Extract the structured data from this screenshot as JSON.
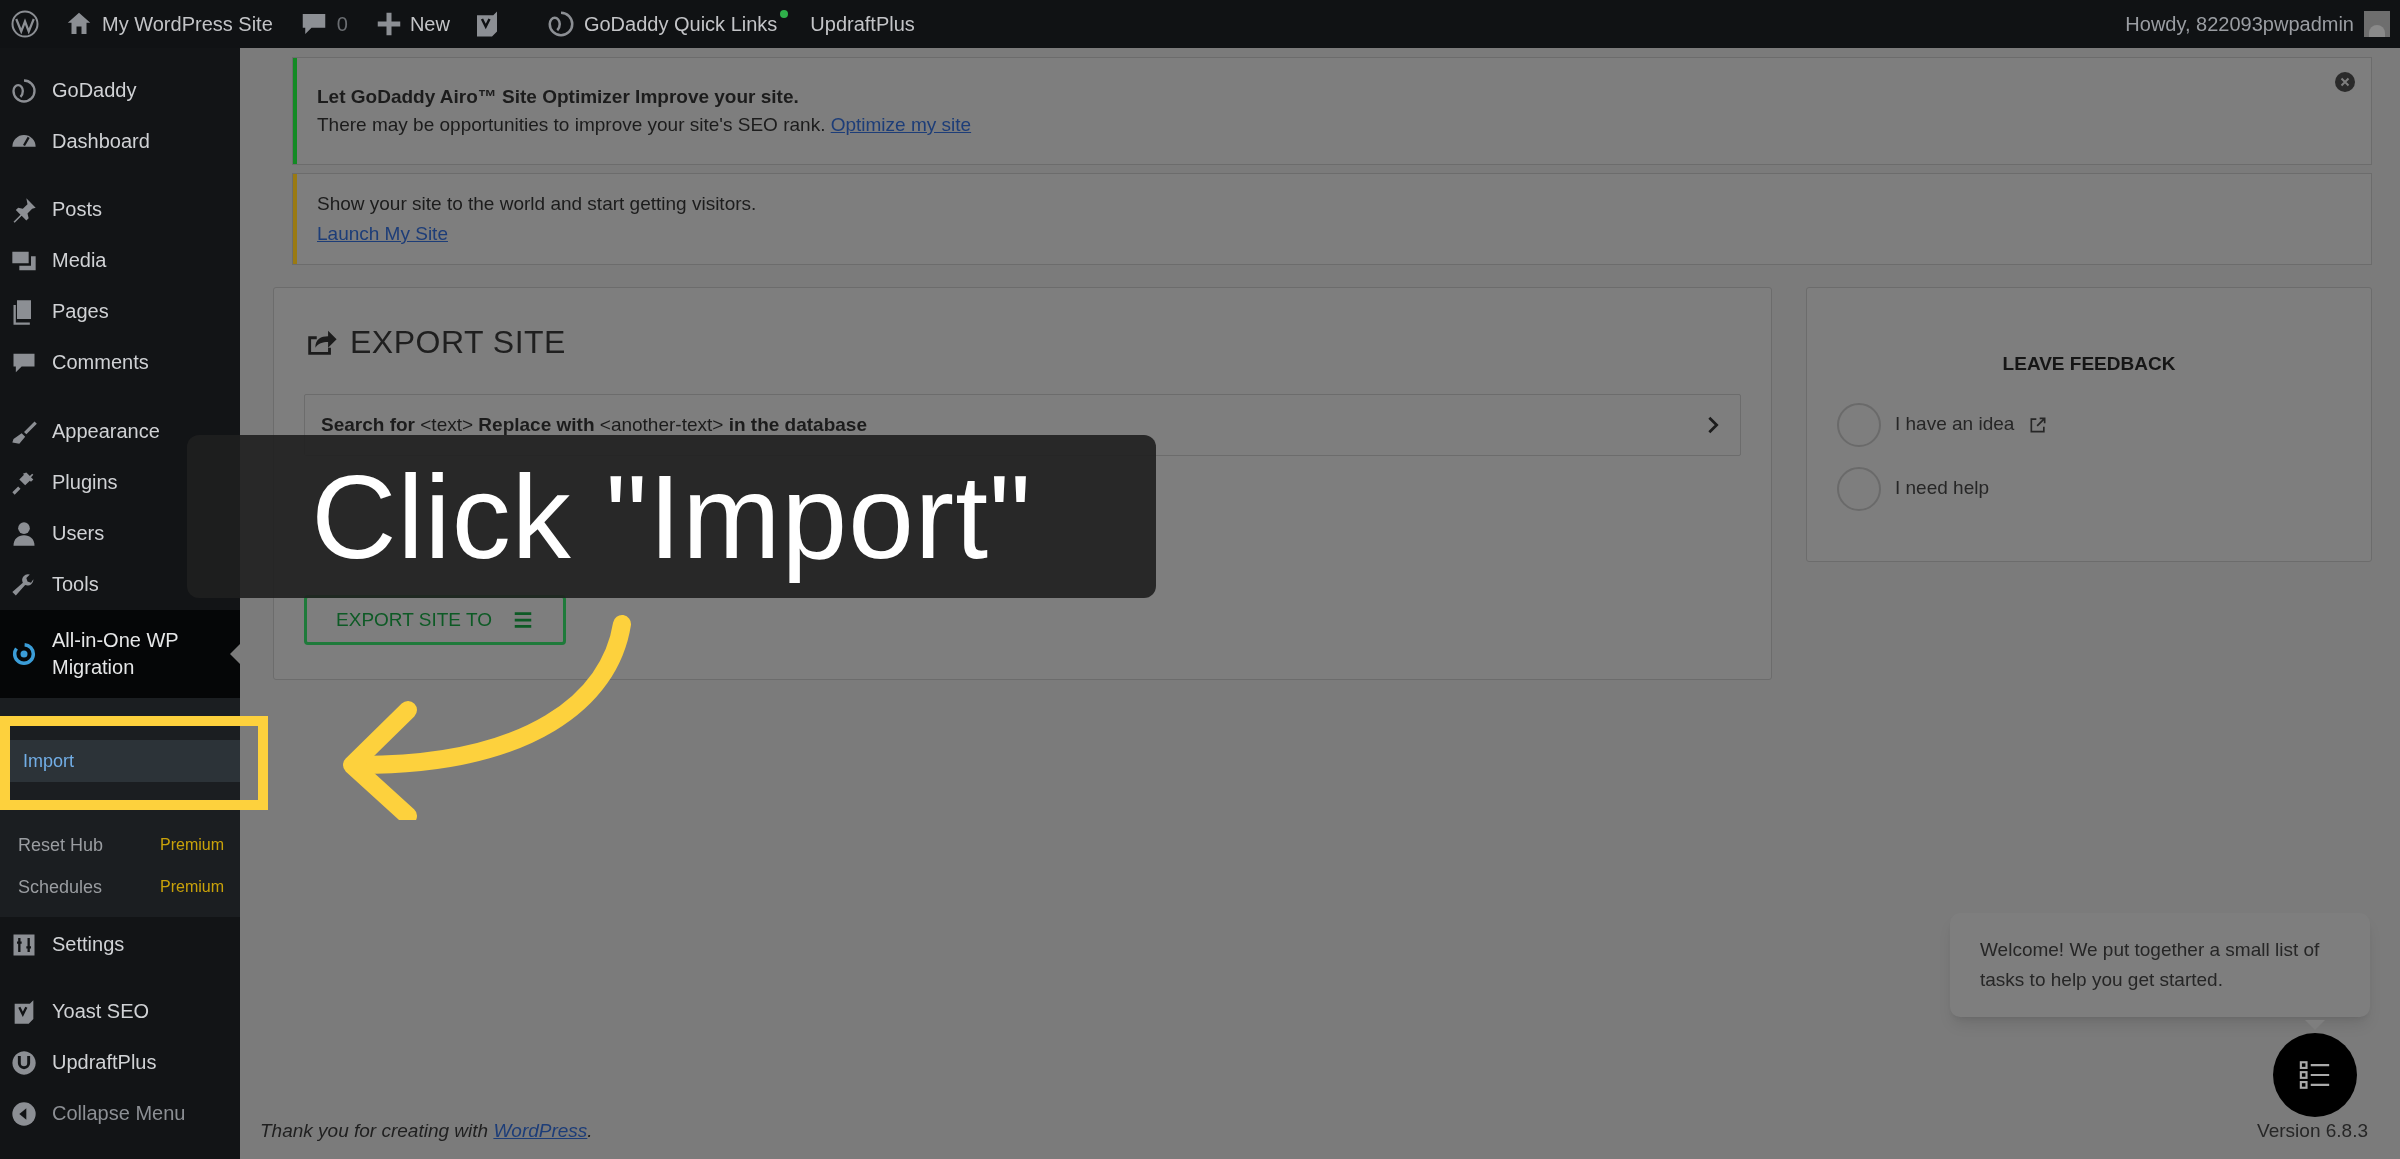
{
  "admin_bar": {
    "site": "My WordPress Site",
    "comments": "0",
    "new": "New",
    "quick_links": "GoDaddy Quick Links",
    "updraft": "UpdraftPlus",
    "howdy": "Howdy, 822093pwpadmin"
  },
  "sidebar": {
    "items": [
      {
        "label": "GoDaddy",
        "selected": false
      },
      {
        "label": "Dashboard",
        "selected": false
      },
      {
        "label": "Posts",
        "selected": false
      },
      {
        "label": "Media",
        "selected": false
      },
      {
        "label": "Pages",
        "selected": false
      },
      {
        "label": "Comments",
        "selected": false
      },
      {
        "label": "Appearance",
        "selected": false
      },
      {
        "label": "Plugins",
        "selected": false
      },
      {
        "label": "Users",
        "selected": false
      },
      {
        "label": "Tools",
        "selected": false
      },
      {
        "label": "All-in-One WP Migration",
        "selected": true,
        "children": [
          {
            "label": "Import",
            "selected": true
          },
          {
            "label": "Reset Hub",
            "selected": false,
            "badge": "Premium"
          },
          {
            "label": "Schedules",
            "selected": false,
            "badge": "Premium"
          }
        ]
      },
      {
        "label": "Settings",
        "selected": false
      },
      {
        "label": "Yoast SEO",
        "selected": false
      },
      {
        "label": "UpdraftPlus",
        "selected": false
      },
      {
        "label": "Collapse Menu",
        "selected": false
      }
    ]
  },
  "notices": [
    {
      "title": "Let GoDaddy Airo™ Site Optimizer Improve your site.",
      "text": "There may be opportunities to improve your site's SEO rank.",
      "link": "Optimize my site",
      "color": "#138a24",
      "dismissible": true
    },
    {
      "text": "Show your site to the world and start getting visitors.",
      "link": "Launch My Site",
      "color": "#9a7a12",
      "dismissible": false
    }
  ],
  "export": {
    "title": "EXPORT SITE",
    "search_replace": "**Search for** <text> **Replace with** <another-text> **in the database**",
    "button": "EXPORT SITE TO"
  },
  "feedback": {
    "title": "LEAVE FEEDBACK",
    "options": [
      {
        "label": "I have an idea",
        "selected": false,
        "external": true
      },
      {
        "label": "I need help",
        "selected": false,
        "external": false
      }
    ]
  },
  "tasks_tip": "Welcome! We put together a small list of tasks to help you get started.",
  "footer": {
    "text": "Thank you for creating with ",
    "link": "WordPress",
    "after": ".",
    "version": "Version 6.8.3"
  },
  "callout": "Click \"Import\""
}
